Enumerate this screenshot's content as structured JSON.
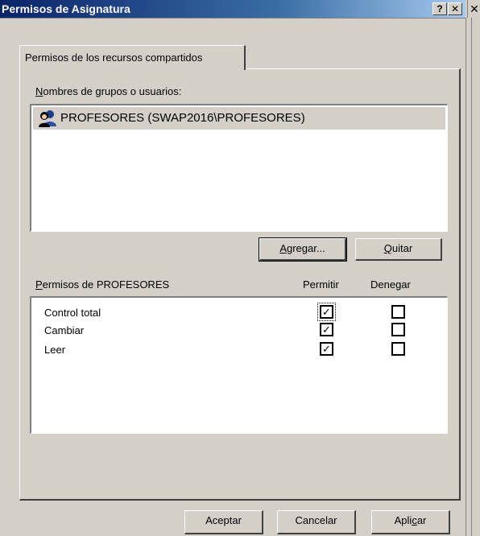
{
  "window": {
    "title": "Permisos de Asignatura",
    "help_label": "?",
    "close_label": "✕",
    "outer_close_label": "✕"
  },
  "tab": {
    "label": "Permisos de los recursos compartidos"
  },
  "groups": {
    "label_prefix": "N",
    "label_rest": "ombres de grupos o usuarios:",
    "items": [
      {
        "name": "PROFESORES (SWAP2016\\PROFESORES)",
        "icon": "group-icon",
        "selected": true
      }
    ]
  },
  "buttons": {
    "agregar_u": "A",
    "agregar_rest": "gregar...",
    "quitar_u": "Q",
    "quitar_rest": "uitar",
    "aceptar": "Aceptar",
    "cancelar": "Cancelar",
    "aplicar_pre": "Apli",
    "aplicar_u": "c",
    "aplicar_post": "ar"
  },
  "permissions": {
    "label_u": "P",
    "label_rest": "ermisos de PROFESORES",
    "col_allow": "Permitir",
    "col_deny": "Denegar",
    "rows": [
      {
        "name": "Control total",
        "allow": true,
        "deny": false
      },
      {
        "name": "Cambiar",
        "allow": true,
        "deny": false
      },
      {
        "name": "Leer",
        "allow": true,
        "deny": false
      }
    ]
  },
  "colors": {
    "dialog_bg": "#d4d0c8",
    "title_start": "#0a246a",
    "title_end": "#a6caf0",
    "list_bg": "#ffffff"
  }
}
